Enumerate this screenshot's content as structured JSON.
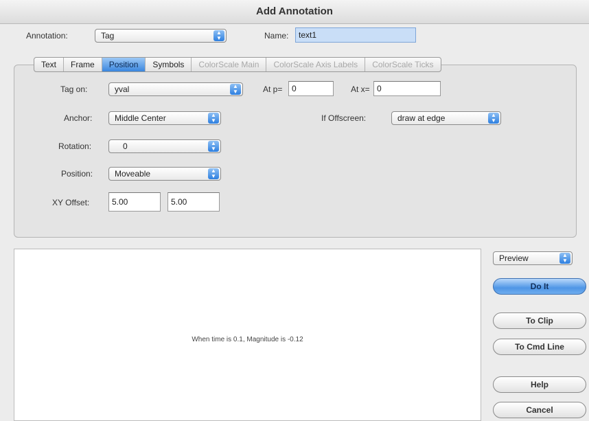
{
  "window": {
    "title": "Add Annotation"
  },
  "annotation": {
    "label": "Annotation:",
    "value": "Tag"
  },
  "name": {
    "label": "Name:",
    "value": "text1"
  },
  "tabs": [
    {
      "label": "Text",
      "state": "normal"
    },
    {
      "label": "Frame",
      "state": "normal"
    },
    {
      "label": "Position",
      "state": "active"
    },
    {
      "label": "Symbols",
      "state": "normal"
    },
    {
      "label": "ColorScale Main",
      "state": "disabled"
    },
    {
      "label": "ColorScale Axis Labels",
      "state": "disabled"
    },
    {
      "label": "ColorScale Ticks",
      "state": "disabled"
    }
  ],
  "position": {
    "tag_on": {
      "label": "Tag on:",
      "value": "yval"
    },
    "at_p": {
      "label": "At p=",
      "value": "0"
    },
    "at_x": {
      "label": "At x=",
      "value": "0"
    },
    "anchor": {
      "label": "Anchor:",
      "value": "Middle Center"
    },
    "if_offscreen": {
      "label": "If Offscreen:",
      "value": "draw at edge"
    },
    "rotation": {
      "label": "Rotation:",
      "value": "0"
    },
    "position_mode": {
      "label": "Position:",
      "value": "Moveable"
    },
    "xy_offset": {
      "label": "XY Offset:",
      "x": "5.00",
      "y": "5.00"
    }
  },
  "preview": {
    "text": "When time is 0.1, Magnitude is -0.12"
  },
  "side": {
    "preview_select": "Preview",
    "do_it": "Do It",
    "to_clip": "To Clip",
    "to_cmd_line": "To Cmd Line",
    "help": "Help",
    "cancel": "Cancel"
  },
  "colors": {
    "accent": "#3a86de",
    "field_highlight": "#c9def7"
  }
}
